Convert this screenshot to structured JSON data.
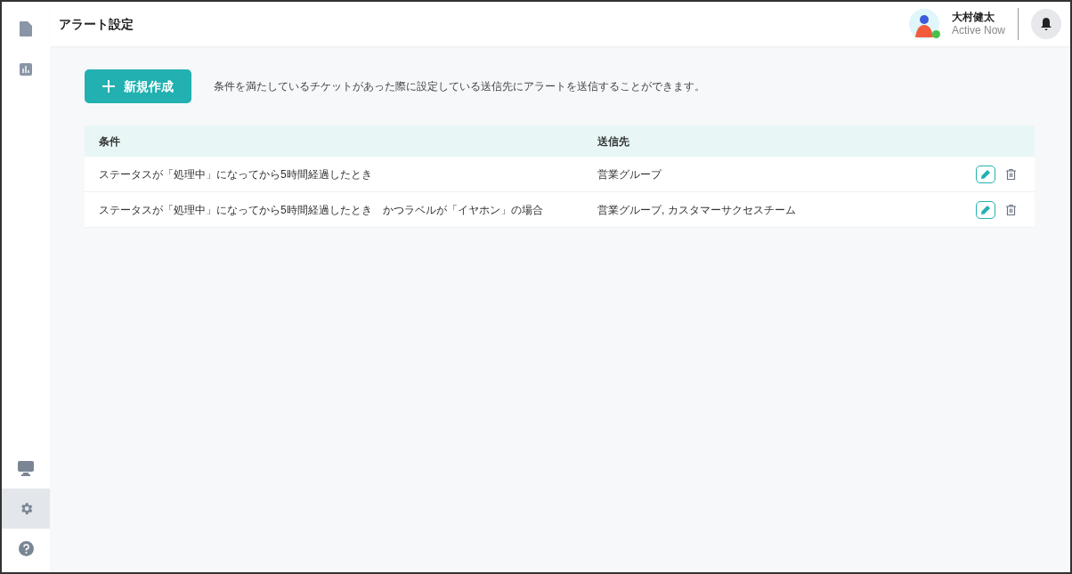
{
  "sidebar": {
    "top_items": [
      {
        "kind": "document",
        "selected": false
      },
      {
        "kind": "chart",
        "selected": false
      }
    ],
    "bottom_items": [
      {
        "kind": "monitor",
        "selected": false
      },
      {
        "kind": "settings",
        "selected": true
      },
      {
        "kind": "help",
        "selected": false
      }
    ]
  },
  "header": {
    "title": "アラート設定",
    "user": {
      "name": "大村健太",
      "status": "Active Now",
      "online": true
    }
  },
  "toolbar": {
    "new_button": "新規作成",
    "description": "条件を満たしているチケットがあった際に設定している送信先にアラートを送信することができます。"
  },
  "table": {
    "columns": [
      "条件",
      "送信先"
    ],
    "rows": [
      {
        "condition": "ステータスが「処理中」になってから5時間経過したとき",
        "recipients": "営業グループ"
      },
      {
        "condition": "ステータスが「処理中」になってから5時間経過したとき　かつラベルが「イヤホン」の場合",
        "recipients": "営業グループ, カスタマーサクセスチーム"
      }
    ]
  }
}
